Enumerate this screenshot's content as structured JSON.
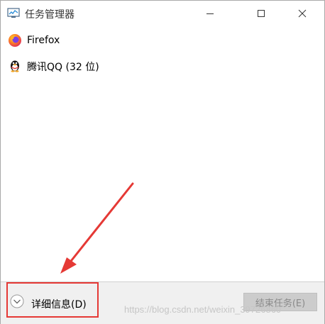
{
  "window": {
    "title": "任务管理器",
    "controls": {
      "minimize": "minimize-icon",
      "maximize": "maximize-icon",
      "close": "close-icon"
    }
  },
  "apps": [
    {
      "name": "Firefox",
      "icon": "firefox-icon"
    },
    {
      "name": "腾讯QQ (32 位)",
      "icon": "qq-penguin-icon"
    }
  ],
  "footer": {
    "more_details_label": "详细信息(D)",
    "end_task_label": "结束任务(E)"
  },
  "watermark": "https://blog.csdn.net/weixin_39726860",
  "colors": {
    "highlight": "#e53935",
    "arrow": "#e53935"
  }
}
